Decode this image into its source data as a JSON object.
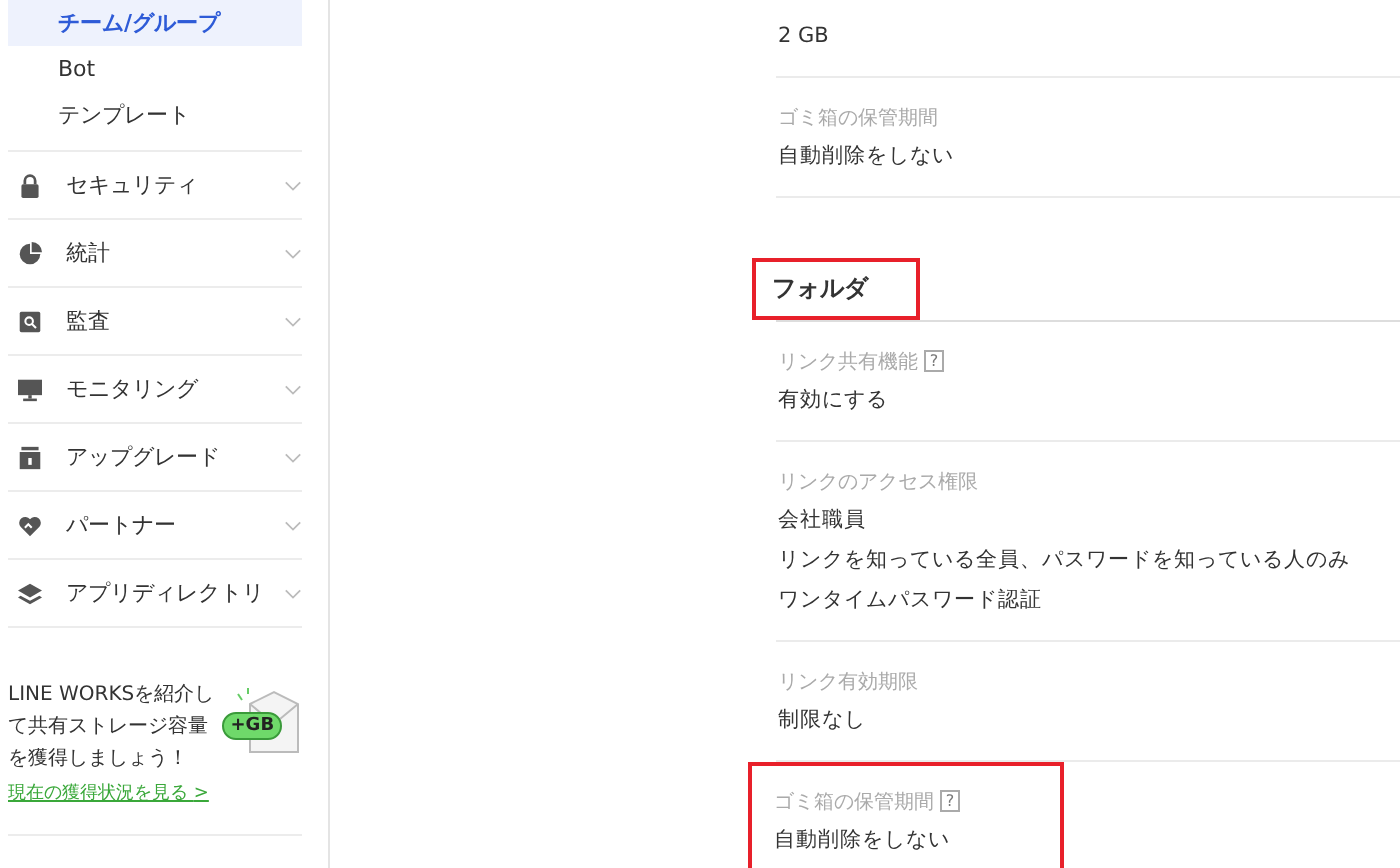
{
  "sidebar": {
    "subitems": [
      {
        "label": "チーム/グループ",
        "selected": true
      },
      {
        "label": "Bot",
        "selected": false
      },
      {
        "label": "テンプレート",
        "selected": false
      }
    ],
    "groups": [
      {
        "label": "セキュリティ"
      },
      {
        "label": "統計"
      },
      {
        "label": "監査"
      },
      {
        "label": "モニタリング"
      },
      {
        "label": "アップグレード"
      },
      {
        "label": "パートナー"
      },
      {
        "label": "アプリディレクトリ"
      }
    ],
    "promo": {
      "text": "LINE WORKSを紹介して共有ストレージ容量を獲得しましょう！",
      "badge": "+GB",
      "link": "現在の獲得状況を見る",
      "link_arrow": ">"
    }
  },
  "content": {
    "items": [
      {
        "kind": "setting",
        "values": [
          "2 GB"
        ],
        "help": false,
        "highlighted": false
      },
      {
        "kind": "setting",
        "label": "ゴミ箱の保管期間",
        "values": [
          "自動削除をしない"
        ],
        "help": false,
        "highlighted": false
      },
      {
        "kind": "heading",
        "text": "フォルダ",
        "highlighted": true
      },
      {
        "kind": "setting",
        "label": "リンク共有機能",
        "help": true,
        "help_mark": "?",
        "values": [
          "有効にする"
        ],
        "highlighted": false
      },
      {
        "kind": "setting",
        "label": "リンクのアクセス権限",
        "help": false,
        "values": [
          "会社職員",
          "リンクを知っている全員、パスワードを知っている人のみ",
          "ワンタイムパスワード認証"
        ],
        "highlighted": false
      },
      {
        "kind": "setting",
        "label": "リンク有効期限",
        "help": false,
        "values": [
          "制限なし"
        ],
        "highlighted": false
      },
      {
        "kind": "setting",
        "label": "ゴミ箱の保管期間",
        "help": true,
        "help_mark": "?",
        "values": [
          "自動削除をしない"
        ],
        "highlighted": true
      }
    ]
  }
}
